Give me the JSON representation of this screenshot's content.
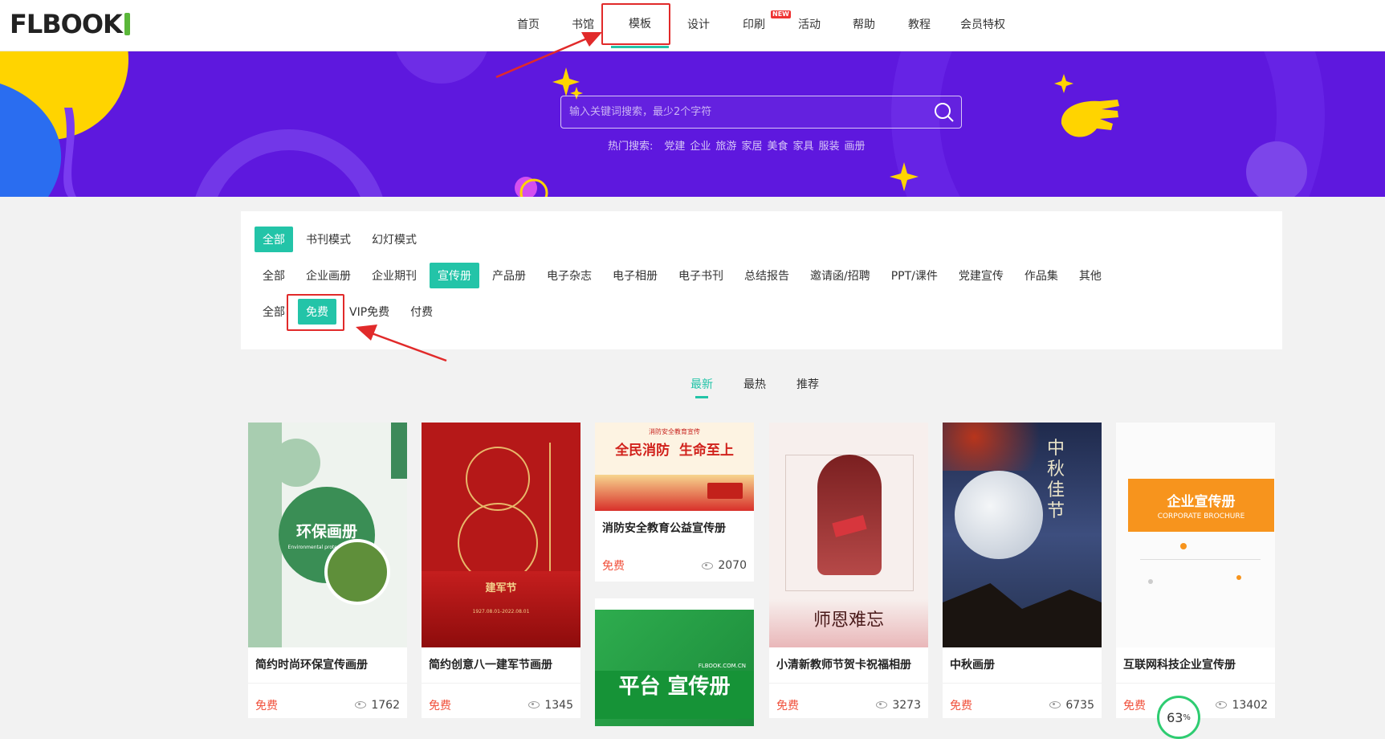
{
  "header": {
    "logo_text": "FLBOOK",
    "nav": [
      {
        "label": "首页"
      },
      {
        "label": "书馆"
      },
      {
        "label": "模板",
        "active": true
      },
      {
        "label": "设计"
      },
      {
        "label": "印刷",
        "badge": "NEW"
      },
      {
        "label": "活动"
      },
      {
        "label": "帮助"
      },
      {
        "label": "教程"
      },
      {
        "label": "会员特权"
      }
    ]
  },
  "banner": {
    "search_placeholder": "输入关键词搜索，最少2个字符",
    "hot_label": "热门搜索:",
    "hot_terms": [
      "党建",
      "企业",
      "旅游",
      "家居",
      "美食",
      "家具",
      "服装",
      "画册"
    ],
    "colors": {
      "background": "#5e18de",
      "accent": "#ffd400"
    }
  },
  "filters": {
    "mode": {
      "items": [
        "全部",
        "书刊模式",
        "幻灯模式"
      ],
      "selected": 0
    },
    "category": {
      "items": [
        "全部",
        "企业画册",
        "企业期刊",
        "宣传册",
        "产品册",
        "电子杂志",
        "电子相册",
        "电子书刊",
        "总结报告",
        "邀请函/招聘",
        "PPT/课件",
        "党建宣传",
        "作品集",
        "其他"
      ],
      "selected": 3
    },
    "price": {
      "items": [
        "全部",
        "免费",
        "VIP免费",
        "付费"
      ],
      "selected": 1
    }
  },
  "sort_tabs": {
    "items": [
      "最新",
      "最热",
      "推荐"
    ],
    "selected": 0
  },
  "cards": [
    {
      "title": "简约时尚环保宣传画册",
      "price": "免费",
      "views": "1762",
      "thumb_title": "环保画册",
      "thumb_sub": "Environmental protection album"
    },
    {
      "title": "简约创意八一建军节画册",
      "price": "免费",
      "views": "1345",
      "thumb_title": "建军节",
      "thumb_sub": "1927.08.01-2022.08.01"
    },
    {
      "title": "消防安全教育公益宣传册",
      "price": "免费",
      "views": "2070",
      "thumb_title": "全民消防  生命至上",
      "thumb_sub": "消防安全教育宣传"
    },
    {
      "title": "小清新教师节贺卡祝福相册",
      "price": "免费",
      "views": "3273",
      "thumb_title": "师恩难忘",
      "thumb_sub": ""
    },
    {
      "title": "中秋画册",
      "price": "免费",
      "views": "6735",
      "thumb_title": "中秋佳节",
      "thumb_sub": ""
    },
    {
      "title": "互联网科技企业宣传册",
      "price": "免费",
      "views": "13402",
      "thumb_title": "企业宣传册",
      "thumb_sub": "CORPORATE BROCHURE"
    },
    {
      "title": "",
      "price": "",
      "views": "",
      "thumb_title": "平台 宣传册",
      "thumb_sub": "FLBOOK.COM.CN"
    }
  ],
  "progress": {
    "value": "63",
    "unit": "%"
  },
  "colors": {
    "brand": "#23c4a8",
    "price_free": "#f0513c",
    "highlight_box": "#e12a2a"
  }
}
